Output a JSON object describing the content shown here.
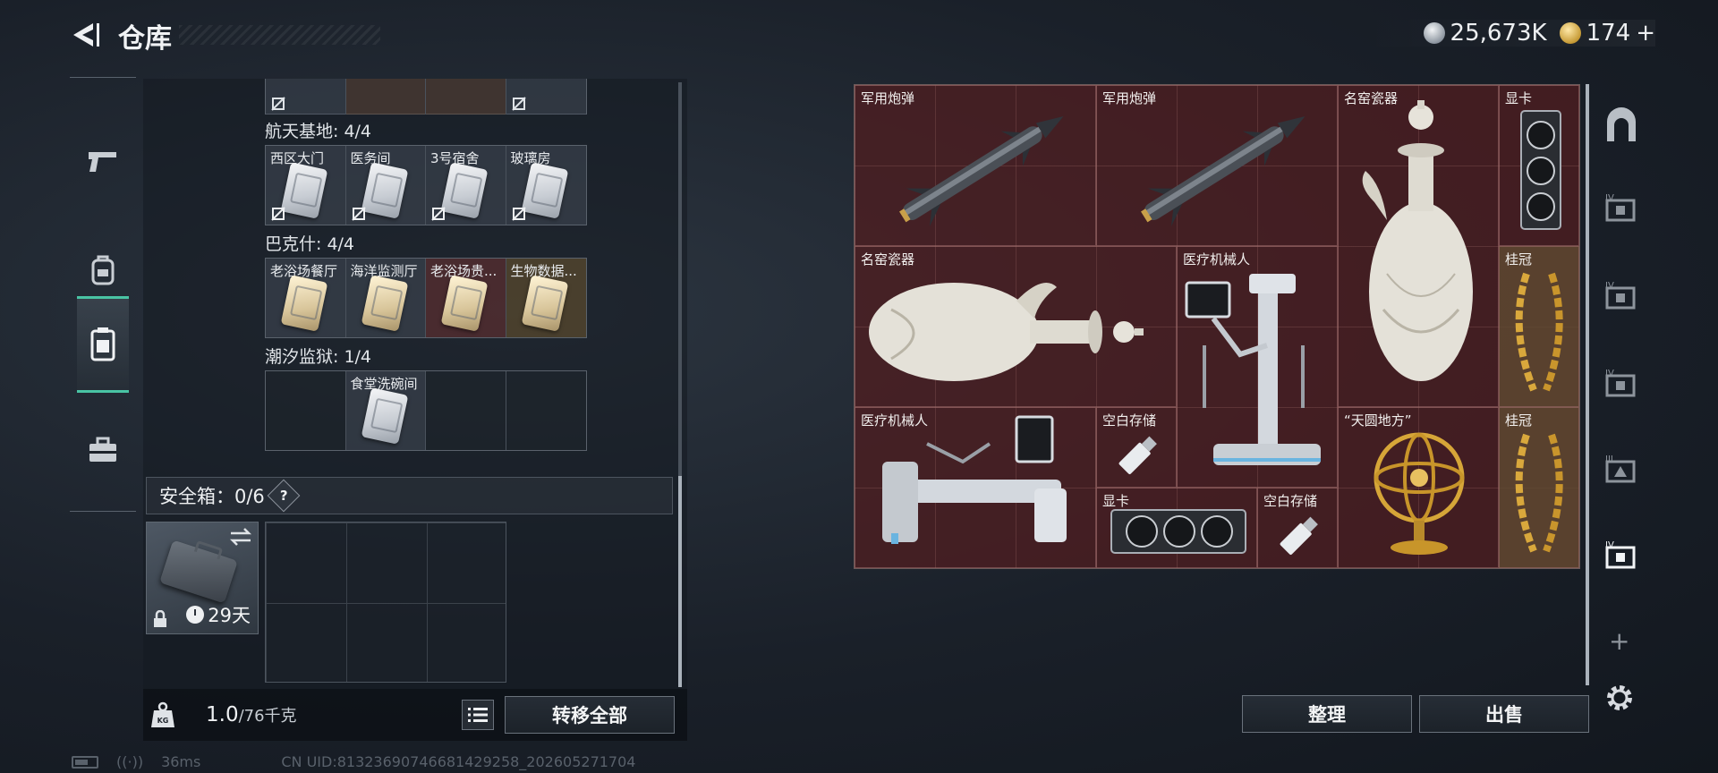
{
  "header": {
    "title": "仓库",
    "silver_amount": "25,673K",
    "gold_amount": "174",
    "gold_plus": "+"
  },
  "left_nav": {
    "items": [
      {
        "name": "weapon",
        "icon": "pistol-icon",
        "active": false
      },
      {
        "name": "equipment",
        "icon": "backpack-icon",
        "active": false
      },
      {
        "name": "cards",
        "icon": "keycard-icon",
        "active": true
      },
      {
        "name": "toolbox",
        "icon": "toolbox-icon",
        "active": false
      }
    ]
  },
  "key_groups": [
    {
      "label": "航天基地: 4/4",
      "cells": [
        {
          "name": "西区大门",
          "locked": true,
          "tint": "gray"
        },
        {
          "name": "医务间",
          "locked": true,
          "tint": "gray"
        },
        {
          "name": "3号宿舍",
          "locked": true,
          "tint": "gray"
        },
        {
          "name": "玻璃房",
          "locked": true,
          "tint": "gray"
        }
      ]
    },
    {
      "label": "巴克什: 4/4",
      "cells": [
        {
          "name": "老浴场餐厅",
          "locked": false,
          "tint": "gray"
        },
        {
          "name": "海洋监测厅",
          "locked": false,
          "tint": "gray"
        },
        {
          "name": "老浴场贵...",
          "locked": false,
          "tint": "red"
        },
        {
          "name": "生物数据...",
          "locked": false,
          "tint": "gold"
        }
      ]
    },
    {
      "label": "潮汐监狱: 1/4",
      "cells": [
        {
          "name": "",
          "empty": true
        },
        {
          "name": "食堂洗碗间",
          "locked": false,
          "tint": "gray"
        },
        {
          "name": "",
          "empty": true
        },
        {
          "name": "",
          "empty": true
        }
      ]
    }
  ],
  "safe_box": {
    "label": "安全箱：0/6",
    "help": "?",
    "days_left": "29天"
  },
  "bottom_left": {
    "weight_current": "1.0",
    "weight_max": "/76千克",
    "transfer_all": "转移全部"
  },
  "stash_items": [
    {
      "name": "军用炮弹",
      "icon": "missile-icon"
    },
    {
      "name": "军用炮弹",
      "icon": "missile-icon"
    },
    {
      "name": "名窑瓷器",
      "icon": "porcelain-vase-icon"
    },
    {
      "name": "显卡",
      "icon": "graphics-card-icon"
    },
    {
      "name": "名窑瓷器",
      "icon": "porcelain-vase-icon"
    },
    {
      "name": "医疗机械人",
      "icon": "medical-robot-icon"
    },
    {
      "name": "桂冠",
      "icon": "laurel-crown-icon"
    },
    {
      "name": "医疗机械人",
      "icon": "medical-robot-icon"
    },
    {
      "name": "空白存储",
      "icon": "usb-drive-icon"
    },
    {
      "name": "“天圆地方”",
      "icon": "armillary-sphere-icon"
    },
    {
      "name": "桂冠",
      "icon": "laurel-crown-icon"
    },
    {
      "name": "显卡",
      "icon": "graphics-card-icon"
    },
    {
      "name": "空白存储",
      "icon": "usb-drive-icon"
    }
  ],
  "bottom_right": {
    "sort": "整理",
    "sell": "出售"
  },
  "right_nav": {
    "items": [
      {
        "name": "stash-main",
        "icon": "arch-icon"
      },
      {
        "name": "stash-iv-1",
        "icon": "stash-iv-icon",
        "roman": "IV"
      },
      {
        "name": "stash-iv-2",
        "icon": "stash-iv-icon",
        "roman": "IV"
      },
      {
        "name": "stash-iv-3",
        "icon": "stash-iv-icon",
        "roman": "IV"
      },
      {
        "name": "stash-iii",
        "icon": "stash-iii-icon",
        "roman": "III"
      },
      {
        "name": "stash-iv-4",
        "icon": "stash-iv-icon",
        "roman": "IV",
        "active": true
      }
    ],
    "add": "+"
  },
  "status": {
    "ping": "36ms",
    "uid": "CN UID:8132369074668142925​8_202605271704"
  },
  "colors": {
    "accent_green": "#49c4a4",
    "stash_red": "#5a2226",
    "panel_dark": "#141920"
  }
}
